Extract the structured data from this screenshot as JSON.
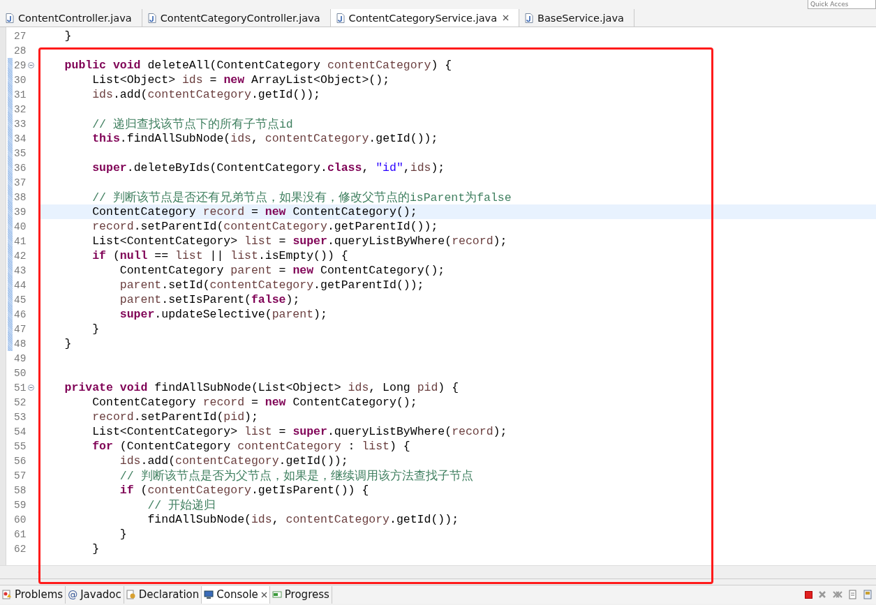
{
  "quick_access": {
    "placeholder": "Quick Acces"
  },
  "editor_tabs": [
    {
      "label": "ContentController.java",
      "selected": false
    },
    {
      "label": "ContentCategoryController.java",
      "selected": false
    },
    {
      "label": "ContentCategoryService.java",
      "selected": true
    },
    {
      "label": "BaseService.java",
      "selected": false
    }
  ],
  "lines": [
    {
      "number": "27",
      "current": false,
      "fold": false,
      "marked": false,
      "tokens": [
        {
          "kind": "plain",
          "text": "    }"
        }
      ]
    },
    {
      "number": "28",
      "current": false,
      "fold": false,
      "marked": false
    },
    {
      "number": "29",
      "current": false,
      "fold": true,
      "marked": true,
      "tokens": [
        {
          "kind": "kw",
          "text": "    public void"
        },
        {
          "kind": "plain",
          "text": " deleteAll(ContentCategory "
        },
        {
          "kind": "var",
          "text": "contentCategory"
        },
        {
          "kind": "plain",
          "text": ") {"
        }
      ]
    },
    {
      "number": "30",
      "current": false,
      "fold": false,
      "marked": true,
      "tokens": [
        {
          "kind": "plain",
          "text": "        List<Object> "
        },
        {
          "kind": "var",
          "text": "ids"
        },
        {
          "kind": "plain",
          "text": " = "
        },
        {
          "kind": "kw",
          "text": "new"
        },
        {
          "kind": "plain",
          "text": " ArrayList<Object>();"
        }
      ]
    },
    {
      "number": "31",
      "current": false,
      "fold": false,
      "marked": true,
      "tokens": [
        {
          "kind": "var",
          "text": "        ids"
        },
        {
          "kind": "plain",
          "text": ".add("
        },
        {
          "kind": "var",
          "text": "contentCategory"
        },
        {
          "kind": "plain",
          "text": ".getId());"
        }
      ]
    },
    {
      "number": "32",
      "current": false,
      "fold": false,
      "marked": true
    },
    {
      "number": "33",
      "current": false,
      "fold": false,
      "marked": true,
      "tokens": [
        {
          "kind": "comment",
          "text": "        // 递归查找该节点下的所有子节点id"
        }
      ]
    },
    {
      "number": "34",
      "current": false,
      "fold": false,
      "marked": true,
      "tokens": [
        {
          "kind": "kw",
          "text": "        this"
        },
        {
          "kind": "plain",
          "text": ".findAllSubNode("
        },
        {
          "kind": "var",
          "text": "ids"
        },
        {
          "kind": "plain",
          "text": ", "
        },
        {
          "kind": "var",
          "text": "contentCategory"
        },
        {
          "kind": "plain",
          "text": ".getId());"
        }
      ]
    },
    {
      "number": "35",
      "current": false,
      "fold": false,
      "marked": true
    },
    {
      "number": "36",
      "current": false,
      "fold": false,
      "marked": true,
      "tokens": [
        {
          "kind": "kw",
          "text": "        super"
        },
        {
          "kind": "plain",
          "text": ".deleteByIds(ContentCategory."
        },
        {
          "kind": "kw",
          "text": "class"
        },
        {
          "kind": "plain",
          "text": ", "
        },
        {
          "kind": "string",
          "text": "\"id\""
        },
        {
          "kind": "plain",
          "text": ","
        },
        {
          "kind": "var",
          "text": "ids"
        },
        {
          "kind": "plain",
          "text": ");"
        }
      ]
    },
    {
      "number": "37",
      "current": false,
      "fold": false,
      "marked": true
    },
    {
      "number": "38",
      "current": false,
      "fold": false,
      "marked": true,
      "tokens": [
        {
          "kind": "comment",
          "text": "        // 判断该节点是否还有兄弟节点，如果没有，修改父节点的isParent为false"
        }
      ]
    },
    {
      "number": "39",
      "current": true,
      "fold": false,
      "marked": true,
      "tokens": [
        {
          "kind": "plain",
          "text": "        ContentCategory "
        },
        {
          "kind": "var",
          "text": "record"
        },
        {
          "kind": "plain",
          "text": " = "
        },
        {
          "kind": "kw",
          "text": "new"
        },
        {
          "kind": "plain",
          "text": " ContentCategory();"
        }
      ]
    },
    {
      "number": "40",
      "current": false,
      "fold": false,
      "marked": true,
      "tokens": [
        {
          "kind": "var",
          "text": "        record"
        },
        {
          "kind": "plain",
          "text": ".setParentId("
        },
        {
          "kind": "var",
          "text": "contentCategory"
        },
        {
          "kind": "plain",
          "text": ".getParentId());"
        }
      ]
    },
    {
      "number": "41",
      "current": false,
      "fold": false,
      "marked": true,
      "tokens": [
        {
          "kind": "plain",
          "text": "        List<ContentCategory> "
        },
        {
          "kind": "var",
          "text": "list"
        },
        {
          "kind": "plain",
          "text": " = "
        },
        {
          "kind": "kw",
          "text": "super"
        },
        {
          "kind": "plain",
          "text": ".queryListByWhere("
        },
        {
          "kind": "var",
          "text": "record"
        },
        {
          "kind": "plain",
          "text": ");"
        }
      ]
    },
    {
      "number": "42",
      "current": false,
      "fold": false,
      "marked": true,
      "tokens": [
        {
          "kind": "kw",
          "text": "        if"
        },
        {
          "kind": "plain",
          "text": " ("
        },
        {
          "kind": "kw",
          "text": "null"
        },
        {
          "kind": "plain",
          "text": " == "
        },
        {
          "kind": "var",
          "text": "list"
        },
        {
          "kind": "plain",
          "text": " || "
        },
        {
          "kind": "var",
          "text": "list"
        },
        {
          "kind": "plain",
          "text": ".isEmpty()) {"
        }
      ]
    },
    {
      "number": "43",
      "current": false,
      "fold": false,
      "marked": true,
      "tokens": [
        {
          "kind": "plain",
          "text": "            ContentCategory "
        },
        {
          "kind": "var",
          "text": "parent"
        },
        {
          "kind": "plain",
          "text": " = "
        },
        {
          "kind": "kw",
          "text": "new"
        },
        {
          "kind": "plain",
          "text": " ContentCategory();"
        }
      ]
    },
    {
      "number": "44",
      "current": false,
      "fold": false,
      "marked": true,
      "tokens": [
        {
          "kind": "var",
          "text": "            parent"
        },
        {
          "kind": "plain",
          "text": ".setId("
        },
        {
          "kind": "var",
          "text": "contentCategory"
        },
        {
          "kind": "plain",
          "text": ".getParentId());"
        }
      ]
    },
    {
      "number": "45",
      "current": false,
      "fold": false,
      "marked": true,
      "tokens": [
        {
          "kind": "var",
          "text": "            parent"
        },
        {
          "kind": "plain",
          "text": ".setIsParent("
        },
        {
          "kind": "kw",
          "text": "false"
        },
        {
          "kind": "plain",
          "text": ");"
        }
      ]
    },
    {
      "number": "46",
      "current": false,
      "fold": false,
      "marked": true,
      "tokens": [
        {
          "kind": "kw",
          "text": "            super"
        },
        {
          "kind": "plain",
          "text": ".updateSelective("
        },
        {
          "kind": "var",
          "text": "parent"
        },
        {
          "kind": "plain",
          "text": ");"
        }
      ]
    },
    {
      "number": "47",
      "current": false,
      "fold": false,
      "marked": true,
      "tokens": [
        {
          "kind": "plain",
          "text": "        }"
        }
      ]
    },
    {
      "number": "48",
      "current": false,
      "fold": false,
      "marked": true,
      "tokens": [
        {
          "kind": "plain",
          "text": "    }"
        }
      ]
    },
    {
      "number": "49",
      "current": false,
      "fold": false,
      "marked": false
    },
    {
      "number": "50",
      "current": false,
      "fold": false,
      "marked": false
    },
    {
      "number": "51",
      "current": false,
      "fold": true,
      "marked": false,
      "tokens": [
        {
          "kind": "kw",
          "text": "    private void"
        },
        {
          "kind": "plain",
          "text": " findAllSubNode(List<Object> "
        },
        {
          "kind": "var",
          "text": "ids"
        },
        {
          "kind": "plain",
          "text": ", Long "
        },
        {
          "kind": "var",
          "text": "pid"
        },
        {
          "kind": "plain",
          "text": ") {"
        }
      ]
    },
    {
      "number": "52",
      "current": false,
      "fold": false,
      "marked": false,
      "tokens": [
        {
          "kind": "plain",
          "text": "        ContentCategory "
        },
        {
          "kind": "var",
          "text": "record"
        },
        {
          "kind": "plain",
          "text": " = "
        },
        {
          "kind": "kw",
          "text": "new"
        },
        {
          "kind": "plain",
          "text": " ContentCategory();"
        }
      ]
    },
    {
      "number": "53",
      "current": false,
      "fold": false,
      "marked": false,
      "tokens": [
        {
          "kind": "var",
          "text": "        record"
        },
        {
          "kind": "plain",
          "text": ".setParentId("
        },
        {
          "kind": "var",
          "text": "pid"
        },
        {
          "kind": "plain",
          "text": ");"
        }
      ]
    },
    {
      "number": "54",
      "current": false,
      "fold": false,
      "marked": false,
      "tokens": [
        {
          "kind": "plain",
          "text": "        List<ContentCategory> "
        },
        {
          "kind": "var",
          "text": "list"
        },
        {
          "kind": "plain",
          "text": " = "
        },
        {
          "kind": "kw",
          "text": "super"
        },
        {
          "kind": "plain",
          "text": ".queryListByWhere("
        },
        {
          "kind": "var",
          "text": "record"
        },
        {
          "kind": "plain",
          "text": ");"
        }
      ]
    },
    {
      "number": "55",
      "current": false,
      "fold": false,
      "marked": false,
      "tokens": [
        {
          "kind": "kw",
          "text": "        for"
        },
        {
          "kind": "plain",
          "text": " (ContentCategory "
        },
        {
          "kind": "var",
          "text": "contentCategory"
        },
        {
          "kind": "plain",
          "text": " : "
        },
        {
          "kind": "var",
          "text": "list"
        },
        {
          "kind": "plain",
          "text": ") {"
        }
      ]
    },
    {
      "number": "56",
      "current": false,
      "fold": false,
      "marked": false,
      "tokens": [
        {
          "kind": "var",
          "text": "            ids"
        },
        {
          "kind": "plain",
          "text": ".add("
        },
        {
          "kind": "var",
          "text": "contentCategory"
        },
        {
          "kind": "plain",
          "text": ".getId());"
        }
      ]
    },
    {
      "number": "57",
      "current": false,
      "fold": false,
      "marked": false,
      "tokens": [
        {
          "kind": "comment",
          "text": "            // 判断该节点是否为父节点，如果是，继续调用该方法查找子节点"
        }
      ]
    },
    {
      "number": "58",
      "current": false,
      "fold": false,
      "marked": false,
      "tokens": [
        {
          "kind": "kw",
          "text": "            if"
        },
        {
          "kind": "plain",
          "text": " ("
        },
        {
          "kind": "var",
          "text": "contentCategory"
        },
        {
          "kind": "plain",
          "text": ".getIsParent()) {"
        }
      ]
    },
    {
      "number": "59",
      "current": false,
      "fold": false,
      "marked": false,
      "tokens": [
        {
          "kind": "comment",
          "text": "                // 开始递归"
        }
      ]
    },
    {
      "number": "60",
      "current": false,
      "fold": false,
      "marked": false,
      "tokens": [
        {
          "kind": "plain",
          "text": "                findAllSubNode("
        },
        {
          "kind": "var",
          "text": "ids"
        },
        {
          "kind": "plain",
          "text": ", "
        },
        {
          "kind": "var",
          "text": "contentCategory"
        },
        {
          "kind": "plain",
          "text": ".getId());"
        }
      ]
    },
    {
      "number": "61",
      "current": false,
      "fold": false,
      "marked": false,
      "tokens": [
        {
          "kind": "plain",
          "text": "            }"
        }
      ]
    },
    {
      "number": "62",
      "current": false,
      "fold": false,
      "marked": false,
      "tokens": [
        {
          "kind": "plain",
          "text": "        }"
        }
      ]
    }
  ],
  "panel_tabs": [
    {
      "label": "Problems",
      "selected": false
    },
    {
      "glyph": "@",
      "label": "Javadoc",
      "selected": false
    },
    {
      "label": "Declaration",
      "selected": false
    },
    {
      "label": "Console",
      "selected": true
    },
    {
      "label": "Progress",
      "selected": false
    }
  ]
}
